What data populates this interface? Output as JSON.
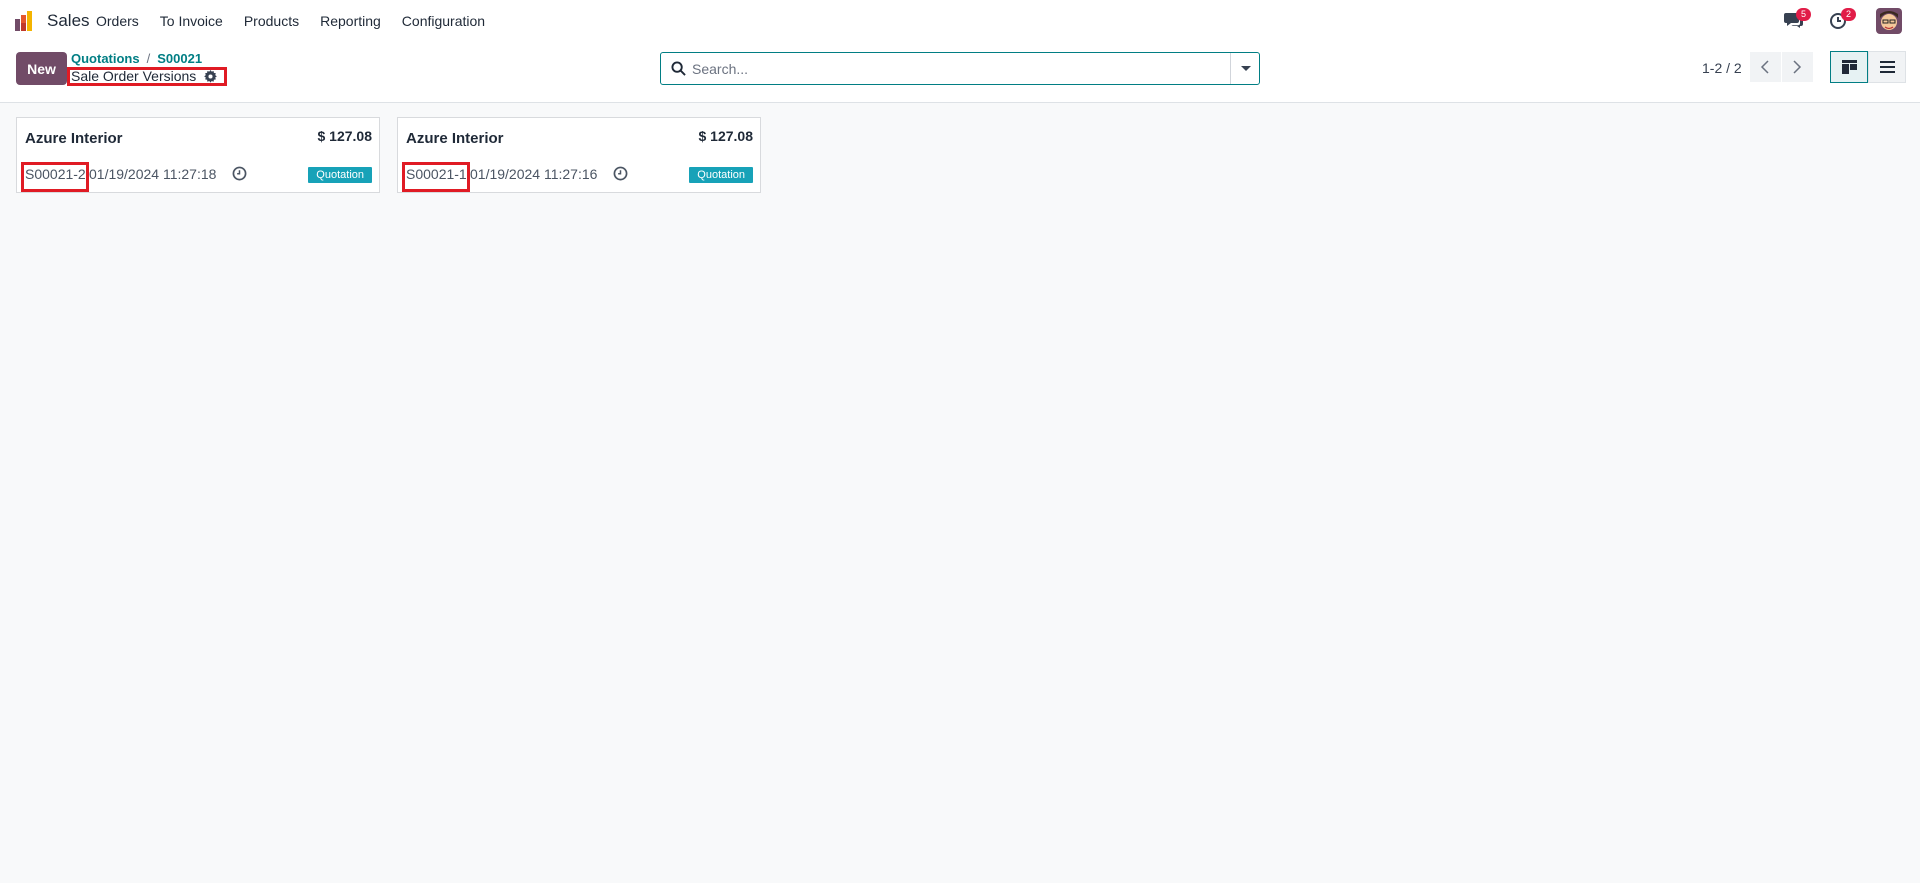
{
  "app": {
    "name": "Sales"
  },
  "menu": [
    "Orders",
    "To Invoice",
    "Products",
    "Reporting",
    "Configuration"
  ],
  "systray": {
    "messages_count": "5",
    "activities_count": "2"
  },
  "control_panel": {
    "new_label": "New",
    "breadcrumb": [
      "Quotations",
      "S00021"
    ],
    "title": "Sale Order Versions",
    "search_placeholder": "Search...",
    "pager": "1-2 / 2"
  },
  "cards": [
    {
      "customer": "Azure Interior",
      "amount": "$ 127.08",
      "ref": "S00021-2",
      "date": "01/19/2024 11:27:18",
      "status": "Quotation"
    },
    {
      "customer": "Azure Interior",
      "amount": "$ 127.08",
      "ref": "S00021-1",
      "date": "01/19/2024 11:27:16",
      "status": "Quotation"
    }
  ],
  "colors": {
    "brand": "#714b67",
    "accent": "#017e84",
    "highlight": "#e01b24",
    "status": "#17a2b8",
    "badge": "#e11d48"
  }
}
